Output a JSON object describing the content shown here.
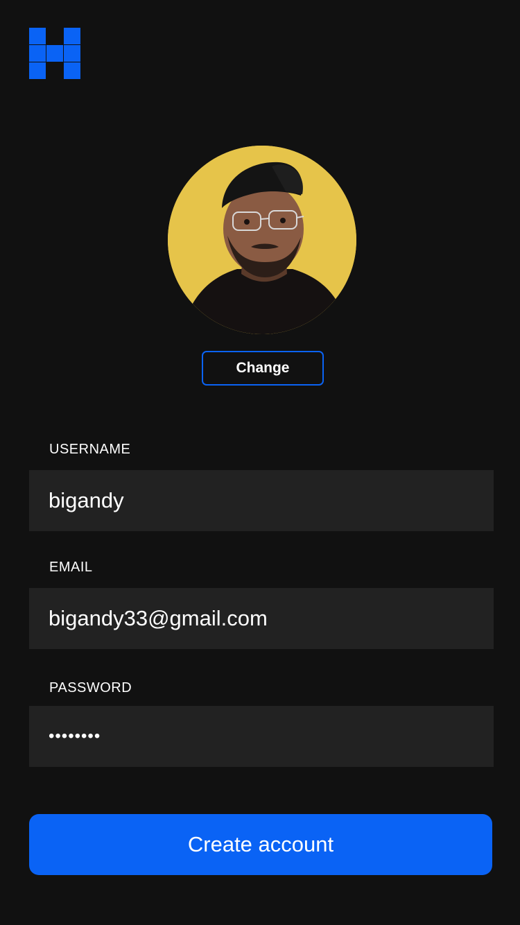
{
  "brand": {
    "logo_icon": "h-pixel-logo-icon",
    "accent_color": "#0a63f5"
  },
  "profile": {
    "avatar_icon": "profile-avatar",
    "change_label": "Change"
  },
  "form": {
    "username": {
      "label": "USERNAME",
      "value": "bigandy"
    },
    "email": {
      "label": "EMAIL",
      "value": "bigandy33@gmail.com"
    },
    "password": {
      "label": "PASSWORD",
      "value": "••••••••"
    }
  },
  "actions": {
    "create_label": "Create account"
  },
  "colors": {
    "background": "#111111",
    "field_bg": "#222222",
    "primary": "#0a63f5",
    "avatar_bg": "#e6c44a"
  }
}
